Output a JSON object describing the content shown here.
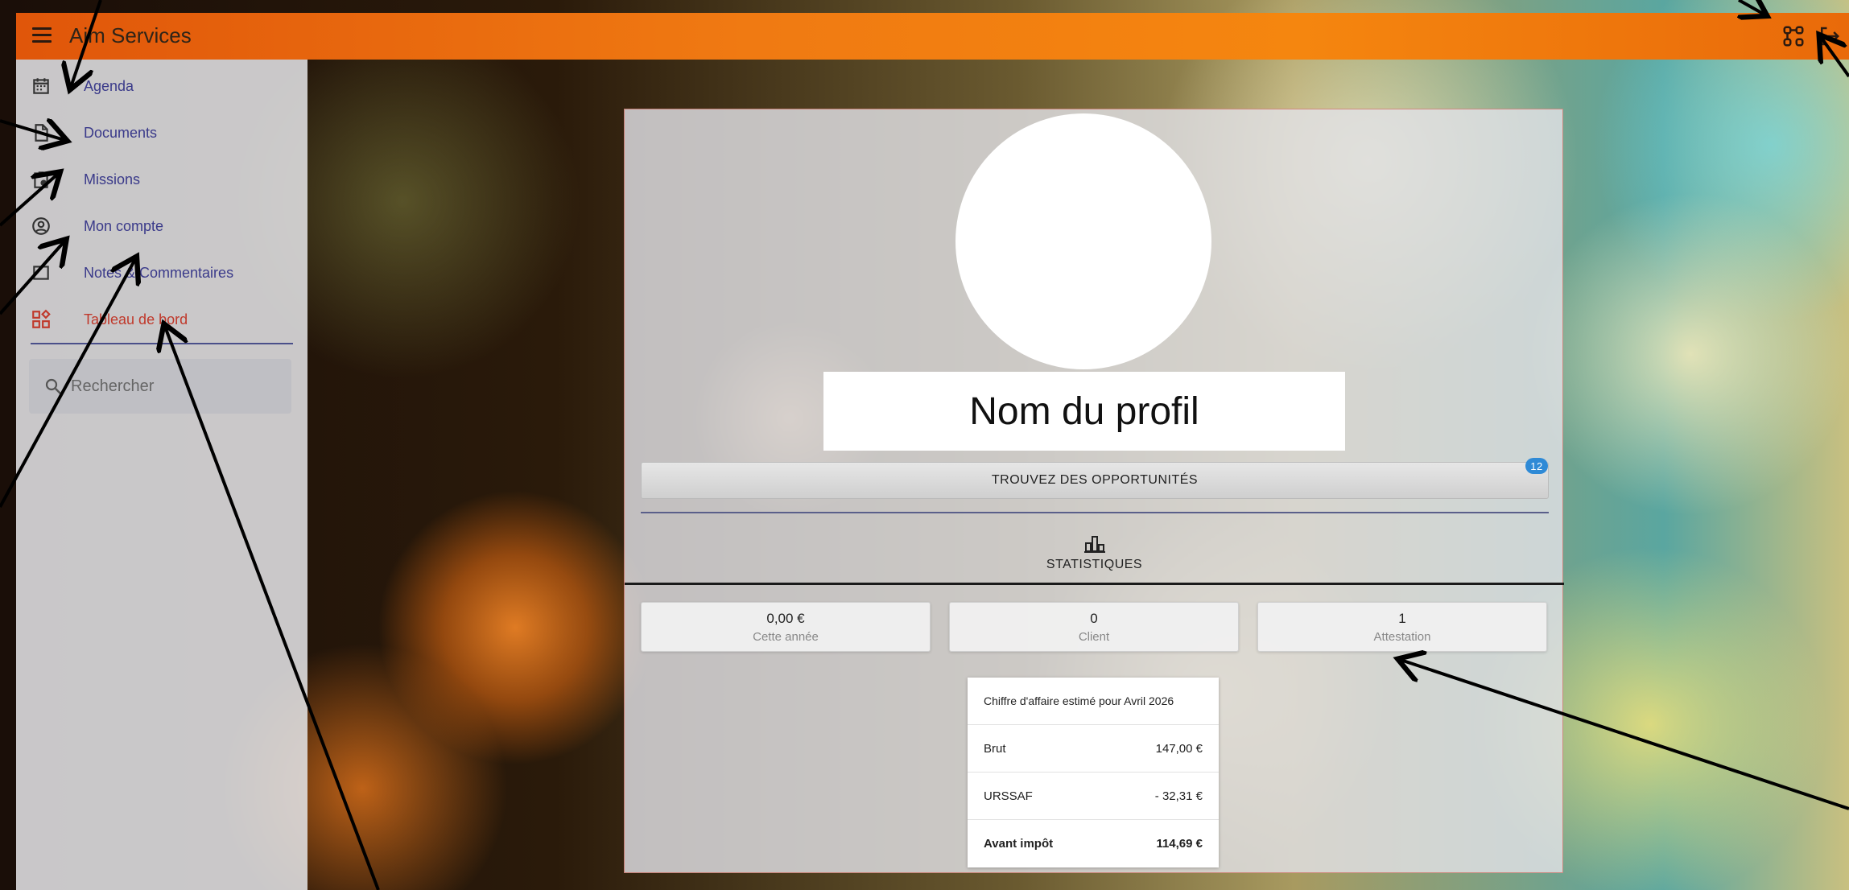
{
  "header": {
    "app_title": "Aim Services",
    "icons": [
      "menu-icon",
      "network-icon",
      "logout-icon"
    ]
  },
  "sidebar": {
    "items": [
      {
        "label": "Agenda",
        "icon": "calendar-icon"
      },
      {
        "label": "Documents",
        "icon": "document-icon"
      },
      {
        "label": "Missions",
        "icon": "clipboard-icon"
      },
      {
        "label": "Mon compte",
        "icon": "account-circle-icon"
      },
      {
        "label": "Notes & Commentaires",
        "icon": "notes-icon"
      },
      {
        "label": "Tableau de bord",
        "icon": "dashboard-icon",
        "active": true
      }
    ],
    "search": {
      "placeholder": "Rechercher",
      "icon": "search-icon"
    }
  },
  "profile": {
    "name": "Nom du profil",
    "opportunities_button": "TROUVEZ DES OPPORTUNITÉS",
    "opportunities_badge": "12",
    "stats_tab_label": "STATISTIQUES",
    "stats_tab_icon": "bar-chart-icon"
  },
  "stats": [
    {
      "value": "0,00 €",
      "label": "Cette année"
    },
    {
      "value": "0",
      "label": "Client"
    },
    {
      "value": "1",
      "label": "Attestation"
    }
  ],
  "revenue_table": {
    "title": "Chiffre d'affaire estimé pour Avril 2026",
    "rows": [
      {
        "label": "Brut",
        "value": "147,00 €"
      },
      {
        "label": "URSSAF",
        "value": "- 32,31 €"
      },
      {
        "label": "Avant impôt",
        "value": "114,69 €"
      }
    ]
  },
  "colors": {
    "topbar": "#f07a12",
    "active_nav": "#c0392b",
    "nav_text": "#3a3a8a",
    "badge": "#2f8ad6"
  }
}
